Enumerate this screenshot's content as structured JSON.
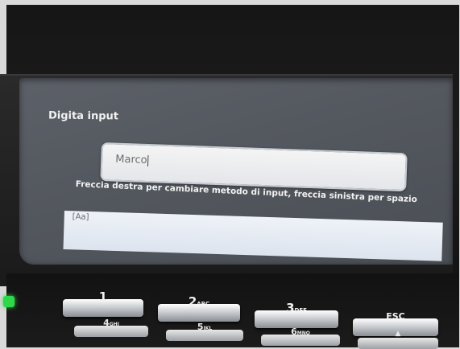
{
  "screen": {
    "title": "Digita input",
    "input_value": "Marco",
    "hint": "Freccia destra per cambiare metodo di input, freccia sinistra per spazio",
    "mode_label": "[Aa]"
  },
  "keypad": {
    "row1": [
      {
        "num": "1",
        "letters": ""
      },
      {
        "num": "2",
        "letters": "ABC"
      },
      {
        "num": "3",
        "letters": "DEF"
      },
      {
        "num": "ESC",
        "letters": ""
      }
    ],
    "row2": [
      {
        "num": "4",
        "letters": "GHI"
      },
      {
        "num": "5",
        "letters": "JKL"
      },
      {
        "num": "6",
        "letters": "MNO"
      },
      {
        "num": "▲",
        "letters": ""
      }
    ]
  },
  "colors": {
    "screen_bg": "#53575e",
    "led": "#2fd84a"
  }
}
